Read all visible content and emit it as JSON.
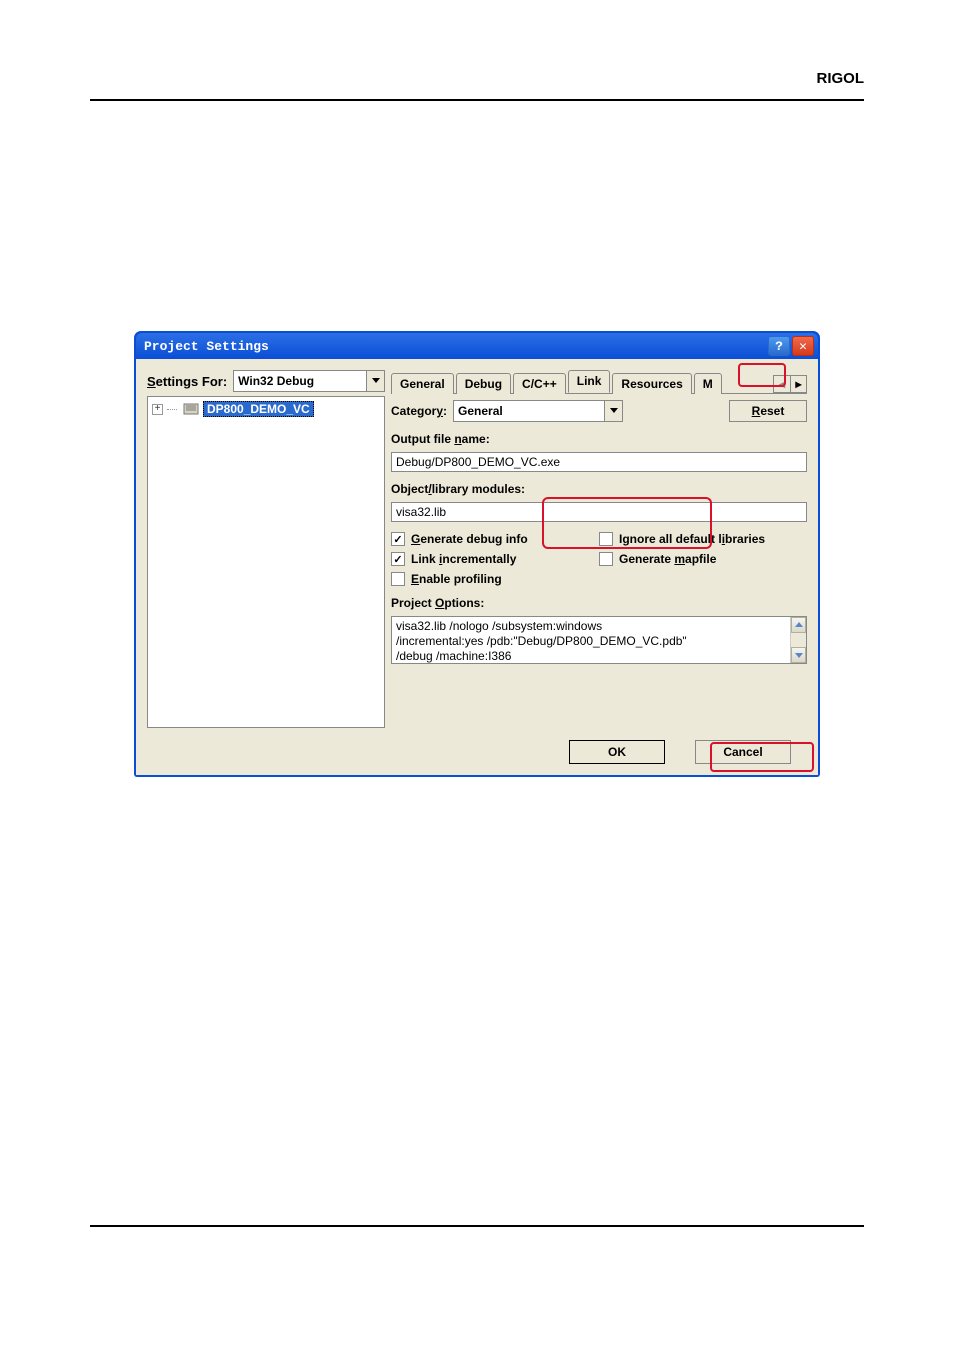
{
  "page": {
    "brand": "RIGOL"
  },
  "dialog": {
    "title": "Project Settings",
    "help_glyph": "?",
    "close_glyph": "✕",
    "settings_for_label_html": "<span class='ul'>S</span>ettings For:",
    "settings_for_value": "Win32 Debug",
    "tree": {
      "expander": "+",
      "root": "DP800_DEMO_VC"
    },
    "tabs": {
      "items": [
        "General",
        "Debug",
        "C/C++",
        "Link",
        "Resources",
        "M"
      ],
      "active_index": 3
    },
    "category_label_html": "Categor<span class='ul'>y</span>:",
    "category_value": "General",
    "reset_label_html": "<span class='ul'>R</span>eset",
    "output_label_html": "Output file <span class='ul'>n</span>ame:",
    "output_value": "Debug/DP800_DEMO_VC.exe",
    "modules_label_html": "Object<span class='ul'>/</span>library modules:",
    "modules_value": "visa32.lib",
    "checks": {
      "gen_debug": {
        "checked": true,
        "label_html": "<span class='ul'>G</span>enerate debug info"
      },
      "ignore_libs": {
        "checked": false,
        "label_html": "Ignore all default l<span class='ul'>i</span>braries"
      },
      "link_incr": {
        "checked": true,
        "label_html": "Link <span class='ul'>i</span>ncrementally"
      },
      "gen_mapfile": {
        "checked": false,
        "label_html": "Generate <span class='ul'>m</span>apfile"
      },
      "enable_prof": {
        "checked": false,
        "label_html": "<span class='ul'>E</span>nable profiling"
      }
    },
    "project_options_label_html": "Project <span class='ul'>O</span>ptions:",
    "project_options_value": "visa32.lib /nologo /subsystem:windows\n/incremental:yes /pdb:\"Debug/DP800_DEMO_VC.pdb\"\n/debug /machine:I386",
    "ok_label": "OK",
    "cancel_label": "Cancel"
  }
}
